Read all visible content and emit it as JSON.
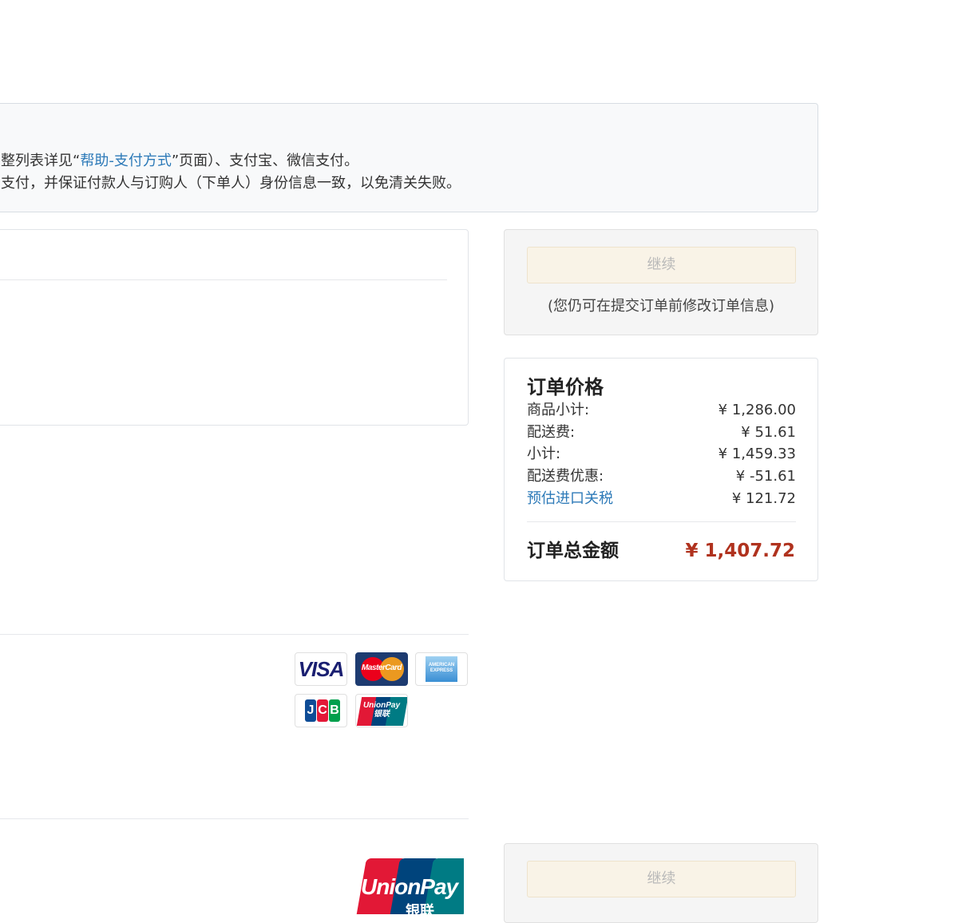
{
  "notice": {
    "line1_pre": "整列表详见“",
    "line1_link": "帮助-支付方式",
    "line1_post": "”页面）、支付宝、微信支付。",
    "line2": "支付，并保证付款人与订购人（下单人）身份信息一致，以免清关失败。"
  },
  "continue_panel": {
    "button_label": "继续",
    "note": "(您仍可在提交订单前修改订单信息)"
  },
  "order_price": {
    "title": "订单价格",
    "rows": [
      {
        "label": "商品小计:",
        "value": "¥ 1,286.00"
      },
      {
        "label": "配送费:",
        "value": "¥ 51.61"
      },
      {
        "label": "小计:",
        "value": "¥ 1,459.33"
      },
      {
        "label": "配送费优惠:",
        "value": "¥ -51.61"
      },
      {
        "label": "预估进口关税",
        "value": "¥ 121.72"
      }
    ],
    "total_label": "订单总金额",
    "total_value": "¥ 1,407.72"
  },
  "cards": {
    "visa": "VISA",
    "mastercard": "MasterCard",
    "amex": "AMERICAN EXPRESS",
    "jcb": [
      "J",
      "C",
      "B"
    ],
    "unionpay_small": [
      "UnionPay",
      "银联"
    ]
  },
  "unionpay_big": {
    "name": "UnionPay",
    "cn": "银联"
  },
  "continue_panel_2": {
    "button_label": "继续"
  },
  "colors": {
    "link": "#2d7ab8",
    "total": "#b0321e",
    "button_bg": "#f9f3e7",
    "unionpay_red": "#e21836",
    "unionpay_blue": "#00447c",
    "unionpay_teal": "#007b84"
  }
}
